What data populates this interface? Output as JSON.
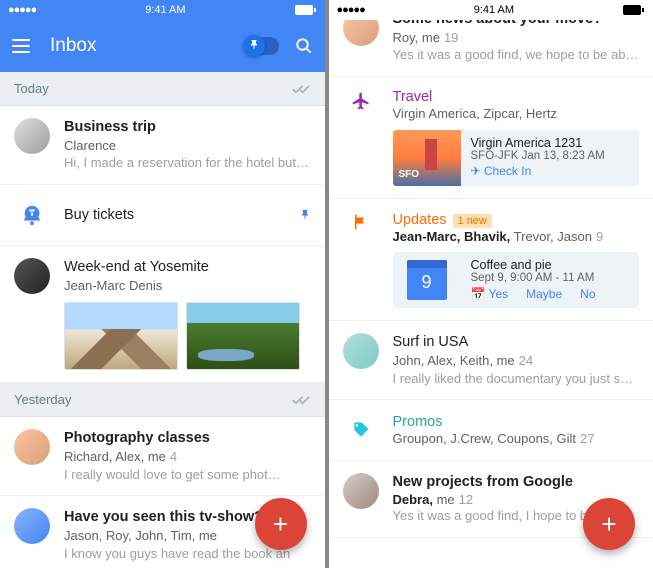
{
  "status": {
    "time": "9:41 AM",
    "dots": "●●●●●"
  },
  "header": {
    "title": "Inbox"
  },
  "sections": {
    "today": "Today",
    "yesterday": "Yesterday"
  },
  "items": {
    "biz": {
      "title": "Business trip",
      "sub": "Clarence",
      "preview": "Hi, I made a reservation for the hotel but it…"
    },
    "buy": {
      "title": "Buy tickets"
    },
    "yosemite": {
      "title": "Week-end at Yosemite",
      "sub": "Jean-Marc Denis"
    },
    "photo": {
      "title": "Photography classes",
      "sub": "Richard, Alex, me",
      "count": "4",
      "preview": "I really would love to get some phot…"
    },
    "tv": {
      "title": "Have you seen this tv-show?",
      "sub": "Jason, Roy, John, Tim, me",
      "preview": "I know you guys have read the book an"
    },
    "move": {
      "title": "Some news about your move?",
      "sub": "Roy, me",
      "count": "19",
      "preview": "Yes it was a good find, we hope to be able …"
    },
    "surf": {
      "title": "Surf in USA",
      "sub": "John, Alex, Keith, me",
      "count": "24",
      "preview": "I really liked the documentary you just sent…"
    },
    "google": {
      "title": "New projects from Google",
      "sub_bold": "Debra,",
      "sub_rest": " me",
      "count": "12",
      "preview": "Yes it was a good find, I hope to be able"
    }
  },
  "bundles": {
    "travel": {
      "title": "Travel",
      "sub": "Virgin America, Zipcar, Hertz"
    },
    "updates": {
      "title": "Updates",
      "badge": "1 new",
      "sub_bold": "Jean-Marc, Bhavik,",
      "sub_rest": " Trevor, Jason",
      "count": "9"
    },
    "promos": {
      "title": "Promos",
      "sub": "Groupon, J.Crew, Coupons, Gilt",
      "count": "27"
    }
  },
  "cards": {
    "flight": {
      "title": "Virgin America 1231",
      "sub": "SFO-JFK Jan 13, 8:23 AM",
      "link": "Check In",
      "origin": "SFO"
    },
    "event": {
      "title": "Coffee and pie",
      "sub": "Sept 9, 9:00 AM - 11 AM",
      "date": "9",
      "yes": "Yes",
      "maybe": "Maybe",
      "no": "No"
    }
  },
  "fab": "+"
}
